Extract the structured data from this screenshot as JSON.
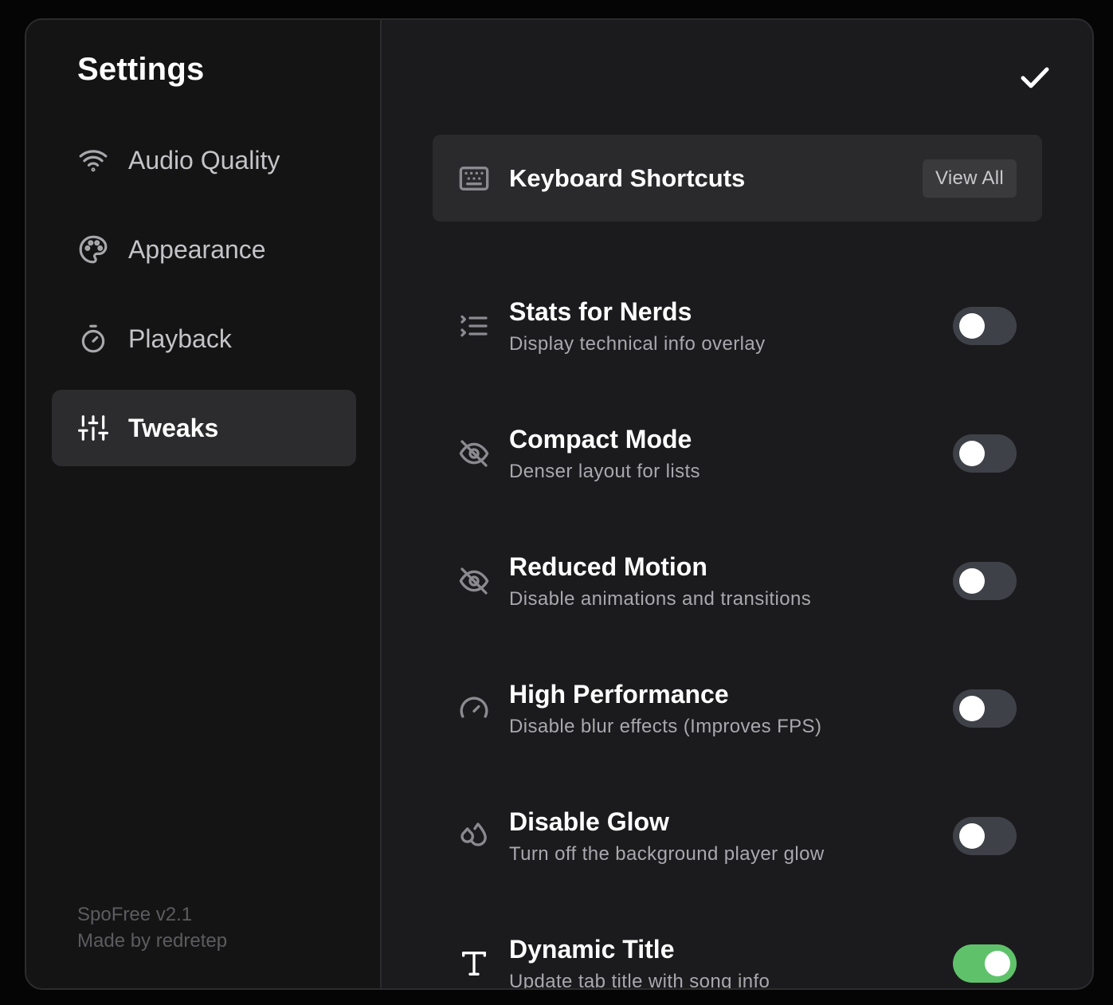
{
  "sidebar": {
    "title": "Settings",
    "items": [
      {
        "label": "Audio Quality",
        "icon": "wifi-icon",
        "active": false
      },
      {
        "label": "Appearance",
        "icon": "palette-icon",
        "active": false
      },
      {
        "label": "Playback",
        "icon": "timer-icon",
        "active": false
      },
      {
        "label": "Tweaks",
        "icon": "sliders-icon",
        "active": true
      }
    ],
    "footer": {
      "version": "SpoFree v2.1",
      "credit": "Made by redretep"
    }
  },
  "main": {
    "done_icon": "check-icon",
    "shortcuts": {
      "title": "Keyboard Shortcuts",
      "icon": "keyboard-icon",
      "button_label": "View All"
    },
    "settings": [
      {
        "title": "Stats for Nerds",
        "desc": "Display technical info overlay",
        "icon": "list-icon",
        "enabled": false
      },
      {
        "title": "Compact Mode",
        "desc": "Denser layout for lists",
        "icon": "eye-off-icon",
        "enabled": false
      },
      {
        "title": "Reduced Motion",
        "desc": "Disable animations and transitions",
        "icon": "eye-off-icon",
        "enabled": false
      },
      {
        "title": "High Performance",
        "desc": "Disable blur effects (Improves FPS)",
        "icon": "gauge-icon",
        "enabled": false
      },
      {
        "title": "Disable Glow",
        "desc": "Turn off the background player glow",
        "icon": "droplets-icon",
        "enabled": false
      },
      {
        "title": "Dynamic Title",
        "desc": "Update tab title with song info",
        "icon": "type-icon",
        "enabled": true
      }
    ]
  },
  "colors": {
    "toggle_on": "#5fc26a",
    "toggle_off": "#3f4148",
    "panel": "#1b1b1d",
    "sidebar": "#141414"
  }
}
